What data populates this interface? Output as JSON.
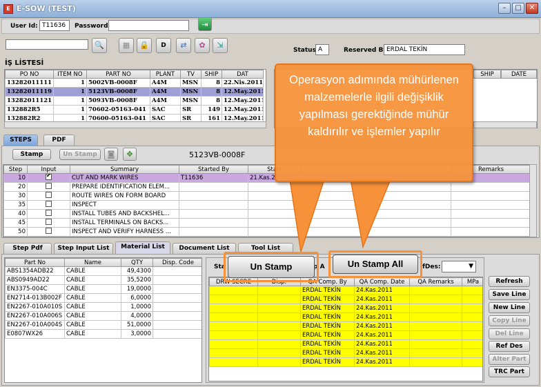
{
  "window": {
    "title": "E-SOW (TEST)"
  },
  "login": {
    "user_id_label": "User Id:",
    "user_id_value": "T11636",
    "password_label": "Password:"
  },
  "toolbar": {
    "d_button": "D"
  },
  "status": {
    "label": "Status:",
    "value": "A",
    "reserved_by_label": "Reserved By:",
    "reserved_by_value": "ERDAL TEKİN"
  },
  "is_listesi": {
    "title": "İŞ LİSTESİ",
    "columns": [
      "PO NO",
      "ITEM NO",
      "PART NO",
      "PLANT",
      "TV",
      "SHIP",
      "DAT"
    ],
    "rows": [
      [
        "13282011111",
        "1",
        "5002VB-0008F",
        "A4M",
        "MSN",
        "8",
        "22.Nis.2011"
      ],
      [
        "13282011119",
        "1",
        "5123VB-0008F",
        "A4M",
        "MSN",
        "8",
        "12.May.2011"
      ],
      [
        "13282011121",
        "1",
        "5093VB-0008F",
        "A4M",
        "MSN",
        "8",
        "12.May.2011"
      ],
      [
        "132882R5",
        "1",
        "70602-05163-041",
        "SAC",
        "SR",
        "149",
        "12.May.2011"
      ],
      [
        "132882R2",
        "1",
        "70600-05163-041",
        "SAC",
        "SR",
        "161",
        "12.May.2011"
      ]
    ]
  },
  "right_table": {
    "columns": [
      "SHIP",
      "DATE"
    ]
  },
  "main_tabs": [
    "STEPS",
    "PDF"
  ],
  "steps_toolbar": {
    "stamp": "Stamp",
    "un_stamp": "Un Stamp",
    "part_no": "5123VB-0008F"
  },
  "steps_table": {
    "columns": [
      "Step",
      "Input",
      "Summary",
      "Started By",
      "Start",
      "Remarks"
    ],
    "rows": [
      {
        "step": "10",
        "input": true,
        "summary": "CUT AND MARK WIRES",
        "started_by": "T11636",
        "start": "21.Kas.2"
      },
      {
        "step": "20",
        "input": false,
        "summary": "PREPARE IDENTIFICATION ELEM...",
        "started_by": "",
        "start": ""
      },
      {
        "step": "30",
        "input": false,
        "summary": "ROUTE WIRES ON FORM BOARD",
        "started_by": "",
        "start": ""
      },
      {
        "step": "35",
        "input": false,
        "summary": "INSPECT",
        "started_by": "",
        "start": ""
      },
      {
        "step": "40",
        "input": false,
        "summary": "INSTALL TUBES AND BACKSHEL...",
        "started_by": "",
        "start": ""
      },
      {
        "step": "45",
        "input": false,
        "summary": "INSTALL TERMINALS ON BACKS...",
        "started_by": "",
        "start": ""
      },
      {
        "step": "50",
        "input": false,
        "summary": "INSPECT AND VERIFY HARNESS ...",
        "started_by": "",
        "start": ""
      }
    ]
  },
  "sub_tabs": [
    "Step Pdf",
    "Step Input List",
    "Material List",
    "Document List",
    "Tool List"
  ],
  "material_table": {
    "columns": [
      "Part No",
      "Name",
      "QTY",
      "Disp. Code"
    ],
    "rows": [
      [
        "ABS1354ADB22",
        "CABLE",
        "49,4300"
      ],
      [
        "ABS0949AD22",
        "CABLE",
        "35,5200"
      ],
      [
        "EN3375-004C",
        "CABLE",
        "19,0000"
      ],
      [
        "EN2714-013B002F",
        "CABLE",
        "6,0000"
      ],
      [
        "EN2267-010A010S",
        "CABLE",
        "1,0000"
      ],
      [
        "EN2267-010A006S",
        "CABLE",
        "4,0000"
      ],
      [
        "EN2267-010A004S",
        "CABLE",
        "51,0000"
      ],
      [
        "E0807WX26",
        "CABLE",
        "3,0000"
      ]
    ]
  },
  "stamp_panel": {
    "partial_label_1": "Sta",
    "partial_label_2": "p A",
    "refdes_label": "fDes:",
    "un_stamp": "Un Stamp",
    "un_stamp_all": "Un Stamp All",
    "columns": [
      "DRW SECRE",
      "Disp.",
      "QA Comp. By",
      "QA Comp. Date",
      "QA Remarks",
      "MPa"
    ],
    "rows": [
      [
        "",
        "",
        "ERDAL TEKİN",
        "24.Kas.2011"
      ],
      [
        "",
        "",
        "ERDAL TEKİN",
        "24.Kas.2011"
      ],
      [
        "",
        "",
        "ERDAL TEKİN",
        "24.Kas.2011"
      ],
      [
        "",
        "",
        "ERDAL TEKİN",
        "24.Kas.2011"
      ],
      [
        "",
        "",
        "ERDAL TEKİN",
        "24.Kas.2011"
      ],
      [
        "",
        "",
        "ERDAL TEKİN",
        "24.Kas.2011"
      ],
      [
        "",
        "",
        "ERDAL TEKİN",
        "24.Kas.2011"
      ],
      [
        "",
        "",
        "ERDAL TEKİN",
        "24.Kas.2011"
      ],
      [
        "",
        "",
        "ERDAL TEKİN",
        "24.Kas.2011"
      ]
    ]
  },
  "right_buttons": [
    "Refresh",
    "Save Line",
    "New Line",
    "Copy Line",
    "Del Line",
    "Ref Des",
    "Alter Part",
    "TRC Part"
  ],
  "callout": {
    "text": "Operasyon adımında mühürlenen malzemelerle ilgili değişiklik yapılması gerektiğinde mühür kaldırılır ve işlemler yapılır"
  },
  "colors": {
    "callout": "#f7923a",
    "highlight_row": "#c9a8e0",
    "selected_row": "#9f9fd6",
    "stamp_rows": "#ffff00"
  }
}
